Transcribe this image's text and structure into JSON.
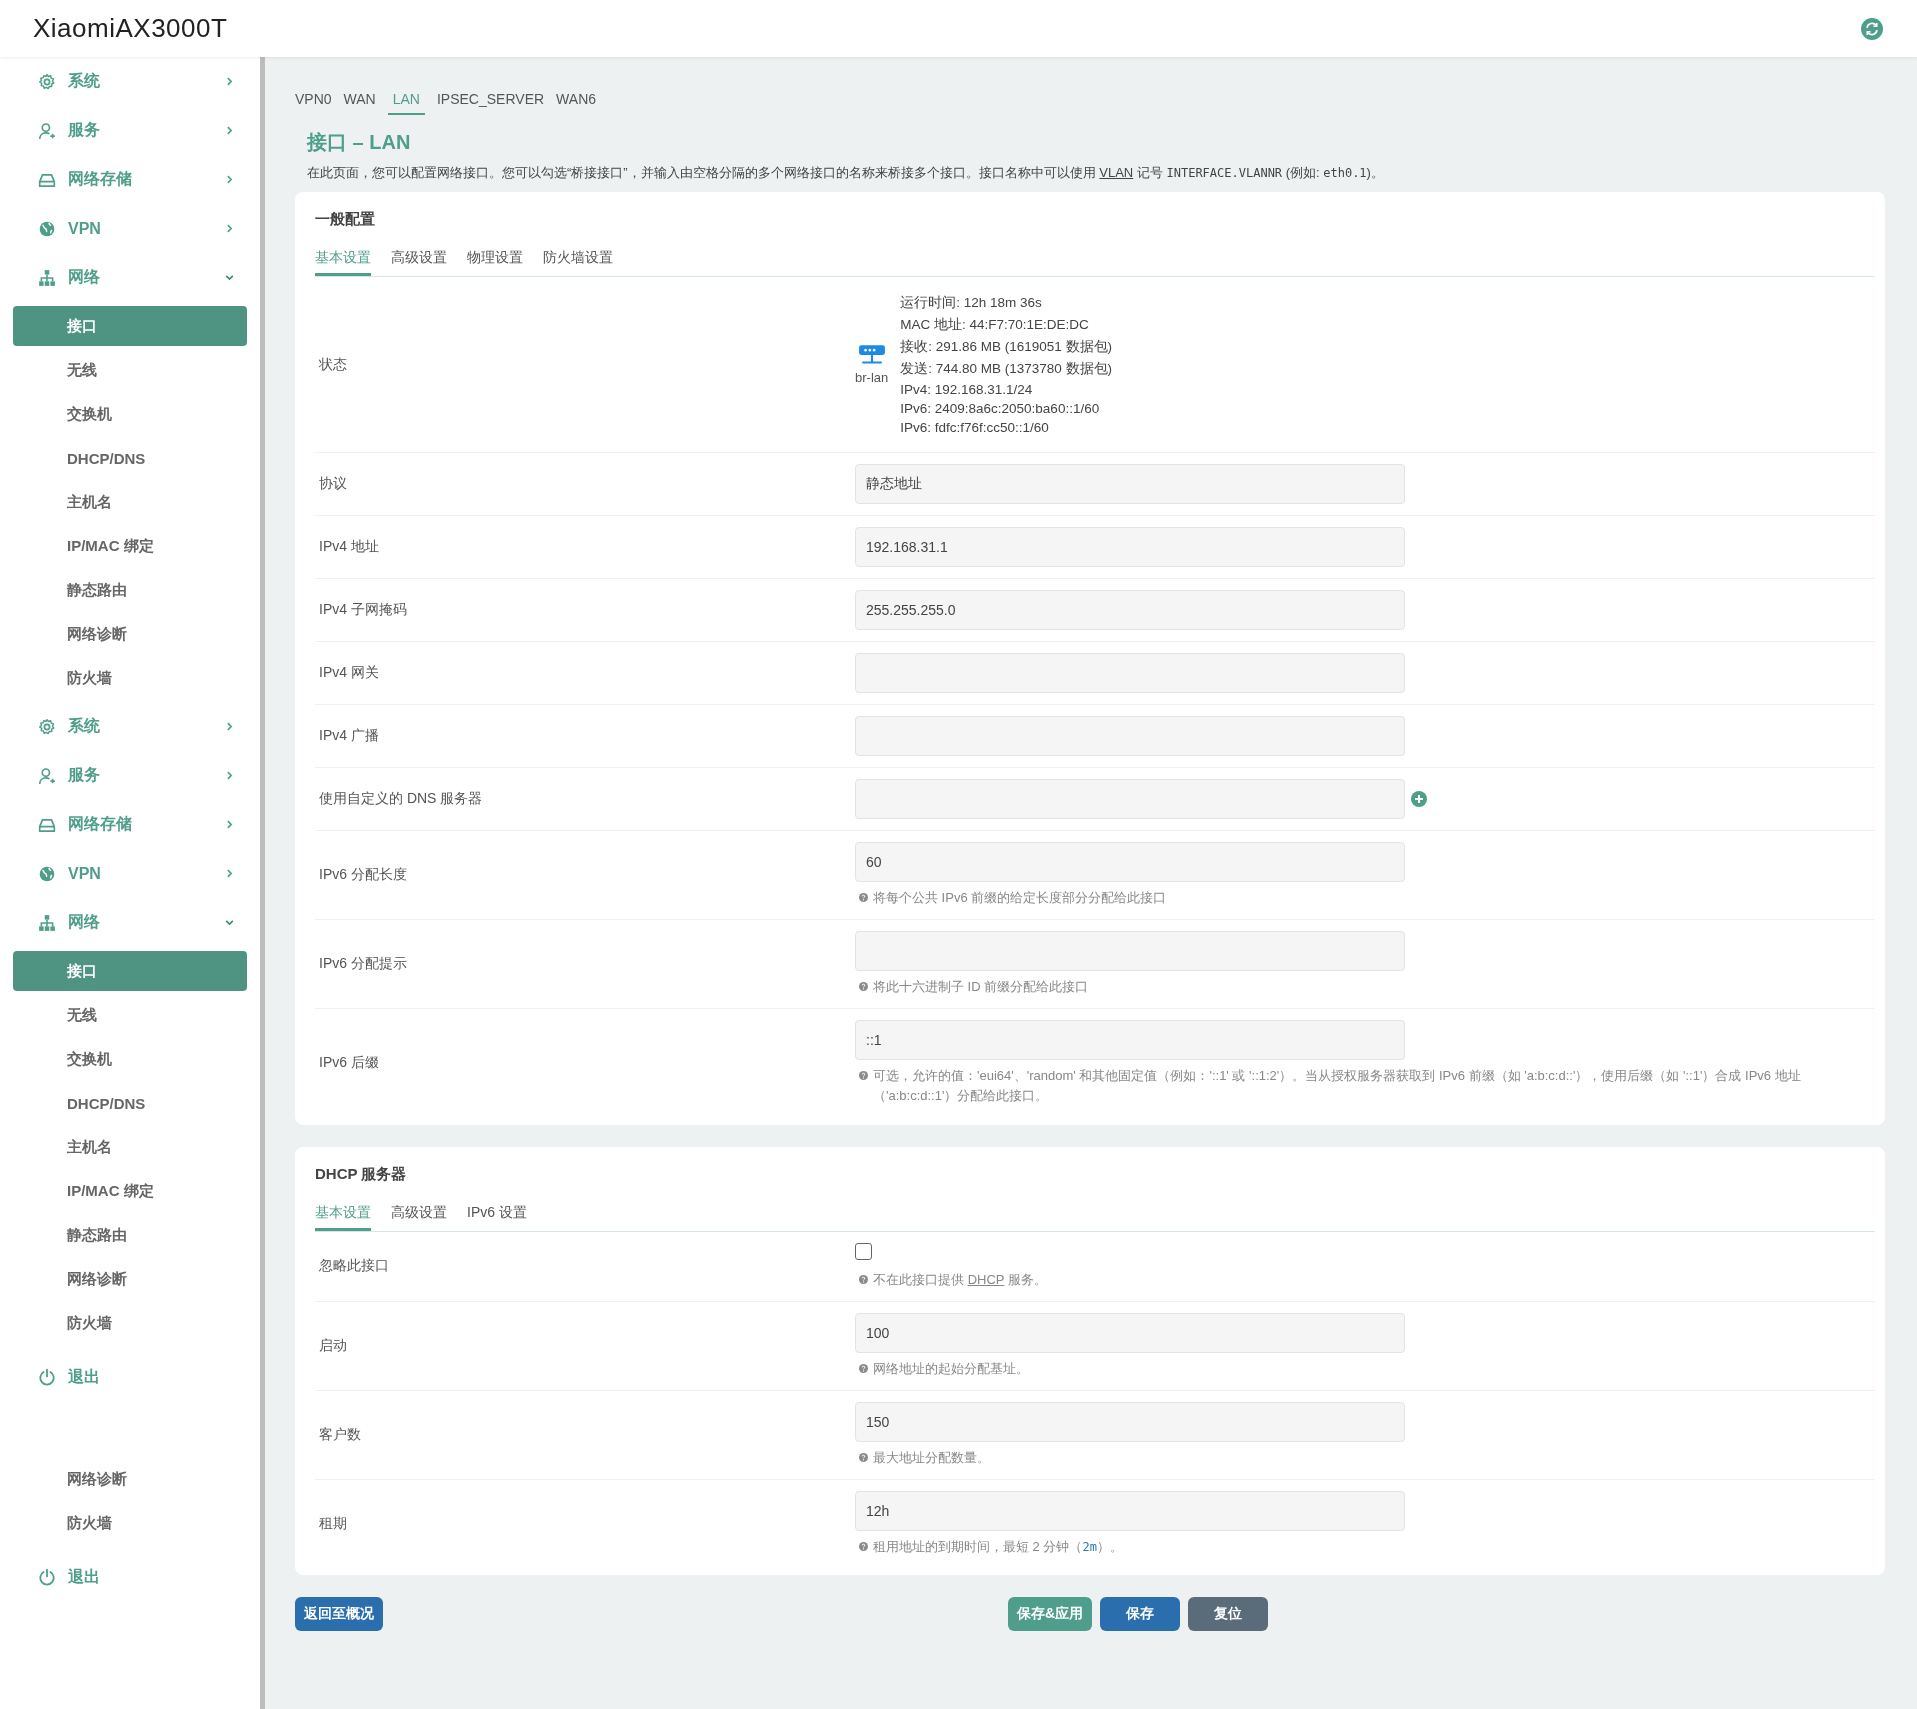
{
  "header": {
    "brand": "XiaomiAX3000T"
  },
  "sidebar": {
    "items": [
      {
        "kind": "settings",
        "label": "系统",
        "expanded": false
      },
      {
        "kind": "services",
        "label": "服务",
        "expanded": false
      },
      {
        "kind": "storage",
        "label": "网络存储",
        "expanded": false
      },
      {
        "kind": "vpn",
        "label": "VPN",
        "expanded": false
      },
      {
        "kind": "network",
        "label": "网络",
        "expanded": true,
        "children": [
          {
            "label": "接口",
            "selected": true
          },
          {
            "label": "无线",
            "selected": false
          },
          {
            "label": "交换机",
            "selected": false
          },
          {
            "label": "DHCP/DNS",
            "selected": false
          },
          {
            "label": "主机名",
            "selected": false
          },
          {
            "label": "IP/MAC 绑定",
            "selected": false
          },
          {
            "label": "静态路由",
            "selected": false
          },
          {
            "label": "网络诊断",
            "selected": false
          },
          {
            "label": "防火墙",
            "selected": false
          }
        ]
      },
      {
        "kind": "settings",
        "label": "系统",
        "expanded": false
      },
      {
        "kind": "services",
        "label": "服务",
        "expanded": false
      },
      {
        "kind": "storage",
        "label": "网络存储",
        "expanded": false
      },
      {
        "kind": "vpn",
        "label": "VPN",
        "expanded": false
      },
      {
        "kind": "network",
        "label": "网络",
        "expanded": true,
        "children": [
          {
            "label": "接口",
            "selected": true
          },
          {
            "label": "无线",
            "selected": false
          },
          {
            "label": "交换机",
            "selected": false
          },
          {
            "label": "DHCP/DNS",
            "selected": false
          },
          {
            "label": "主机名",
            "selected": false
          },
          {
            "label": "IP/MAC 绑定",
            "selected": false
          },
          {
            "label": "静态路由",
            "selected": false
          },
          {
            "label": "网络诊断",
            "selected": false
          },
          {
            "label": "防火墙",
            "selected": false
          }
        ]
      },
      {
        "kind": "logout",
        "label": "退出"
      },
      {
        "kind": "fragment",
        "children": [
          {
            "label": "网络诊断",
            "selected": false
          },
          {
            "label": "防火墙",
            "selected": false
          }
        ]
      },
      {
        "kind": "logout",
        "label": "退出"
      }
    ]
  },
  "interface_tabs": [
    {
      "label": "VPN0",
      "selected": false
    },
    {
      "label": "WAN",
      "selected": false
    },
    {
      "label": "LAN",
      "selected": true
    },
    {
      "label": "IPSEC_SERVER",
      "selected": false
    },
    {
      "label": "WAN6",
      "selected": false
    }
  ],
  "page_title": "接口 – LAN",
  "description": [
    {
      "kind": "plain",
      "text": "在此页面，您可以配置网络接口。您可以勾选“桥接接口”，并输入由空格分隔的多个网络接口的名称来桥接多个接口。接口名称中可以使用 "
    },
    {
      "kind": "abbr",
      "text": "VLAN"
    },
    {
      "kind": "plain",
      "text": " 记号 "
    },
    {
      "kind": "code",
      "text": "INTERFACE.VLANNR"
    },
    {
      "kind": "plain",
      "text": " (例如: "
    },
    {
      "kind": "code",
      "text": "eth0.1"
    },
    {
      "kind": "plain",
      "text": ")。"
    }
  ],
  "sections": [
    {
      "title": "一般配置",
      "tabs": [
        {
          "label": "基本设置",
          "selected": true
        },
        {
          "label": "高级设置",
          "selected": false
        },
        {
          "label": "物理设置",
          "selected": false
        },
        {
          "label": "防火墙设置",
          "selected": false
        }
      ],
      "rows": [
        {
          "kind": "status",
          "label": "状态",
          "device": "br-lan",
          "lines": [
            "运行时间: 12h 18m 36s",
            "MAC 地址: 44:F7:70:1E:DE:DC",
            "接收: 291.86 MB (1619051 数据包)",
            "发送: 744.80 MB (1373780 数据包)",
            "IPv4: 192.168.31.1/24",
            "IPv6: 2409:8a6c:2050:ba60::1/60",
            "IPv6: fdfc:f76f:cc50::1/60"
          ]
        },
        {
          "kind": "input",
          "label": "协议",
          "value": "静态地址"
        },
        {
          "kind": "input",
          "label": "IPv4 地址",
          "value": "192.168.31.1"
        },
        {
          "kind": "input",
          "label": "IPv4 子网掩码",
          "value": "255.255.255.0"
        },
        {
          "kind": "input",
          "label": "IPv4 网关"
        },
        {
          "kind": "input",
          "label": "IPv4 广播"
        },
        {
          "kind": "input",
          "label": "使用自定义的 DNS 服务器",
          "add_button": true
        },
        {
          "kind": "input",
          "label": "IPv6 分配长度",
          "value": "60",
          "help": [
            {
              "kind": "plain",
              "text": "将每个公共 IPv6 前缀的给定长度部分分配给此接口"
            }
          ]
        },
        {
          "kind": "input",
          "label": "IPv6 分配提示",
          "help": [
            {
              "kind": "plain",
              "text": "将此十六进制子 ID 前缀分配给此接口"
            }
          ]
        },
        {
          "kind": "input",
          "label": "IPv6 后缀",
          "value": "::1",
          "help": [
            {
              "kind": "plain",
              "text": "可选，允许的值：'eui64'、'random' 和其他固定值（例如：'::1' 或 '::1:2'）。当从授权服务器获取到 IPv6 前缀（如 'a:b:c:d::'），使用后缀（如 '::1'）合成 IPv6 地址（'a:b:c:d::1'）分配给此接口。"
            }
          ]
        }
      ]
    },
    {
      "title": "DHCP 服务器",
      "tabs": [
        {
          "label": "基本设置",
          "selected": true
        },
        {
          "label": "高级设置",
          "selected": false
        },
        {
          "label": "IPv6 设置",
          "selected": false
        }
      ],
      "rows": [
        {
          "kind": "checkbox",
          "label": "忽略此接口",
          "checked": false,
          "help": [
            {
              "kind": "plain",
              "text": "不在此接口提供 "
            },
            {
              "kind": "abbr",
              "text": "DHCP"
            },
            {
              "kind": "plain",
              "text": " 服务。"
            }
          ]
        },
        {
          "kind": "input",
          "label": "启动",
          "value": "100",
          "help": [
            {
              "kind": "plain",
              "text": "网络地址的起始分配基址。"
            }
          ]
        },
        {
          "kind": "input",
          "label": "客户数",
          "value": "150",
          "help": [
            {
              "kind": "plain",
              "text": "最大地址分配数量。"
            }
          ]
        },
        {
          "kind": "input",
          "label": "租期",
          "value": "12h",
          "help": [
            {
              "kind": "plain",
              "text": "租用地址的到期时间，最短 2 分钟（"
            },
            {
              "kind": "code",
              "text": "2m"
            },
            {
              "kind": "plain",
              "text": "）。"
            }
          ]
        }
      ]
    }
  ],
  "buttons": [
    {
      "kind": "back",
      "label": "返回至概况"
    },
    {
      "kind": "apply",
      "label": "保存&应用"
    },
    {
      "kind": "save",
      "label": "保存"
    },
    {
      "kind": "reset",
      "label": "复位"
    }
  ]
}
